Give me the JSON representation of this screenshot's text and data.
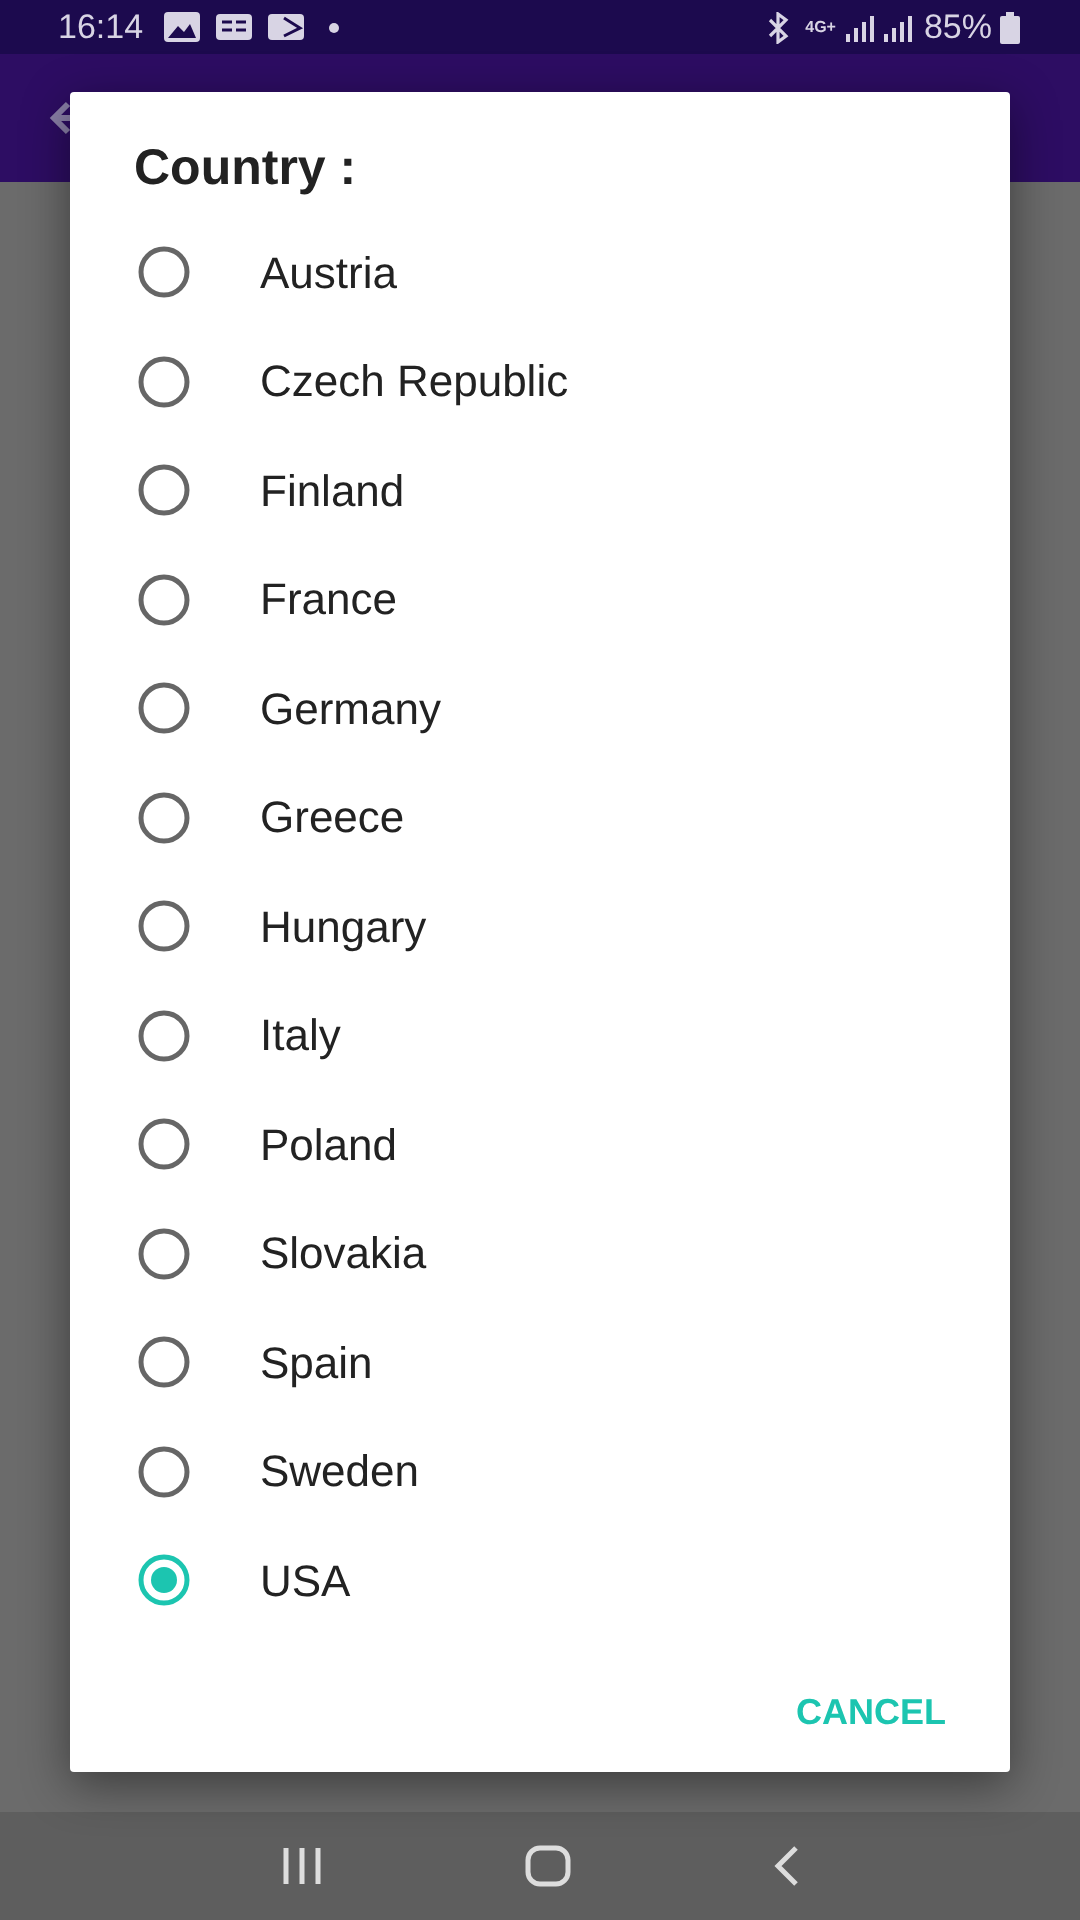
{
  "status_bar": {
    "time": "16:14",
    "network": "4G+",
    "battery": "85%"
  },
  "dialog": {
    "title": "Country :",
    "options": [
      {
        "label": "Austria",
        "selected": false
      },
      {
        "label": "Czech Republic",
        "selected": false
      },
      {
        "label": "Finland",
        "selected": false
      },
      {
        "label": "France",
        "selected": false
      },
      {
        "label": "Germany",
        "selected": false
      },
      {
        "label": "Greece",
        "selected": false
      },
      {
        "label": "Hungary",
        "selected": false
      },
      {
        "label": "Italy",
        "selected": false
      },
      {
        "label": "Poland",
        "selected": false
      },
      {
        "label": "Slovakia",
        "selected": false
      },
      {
        "label": "Spain",
        "selected": false
      },
      {
        "label": "Sweden",
        "selected": false
      },
      {
        "label": "USA",
        "selected": true
      }
    ],
    "buttons": [
      "CANCEL"
    ]
  }
}
